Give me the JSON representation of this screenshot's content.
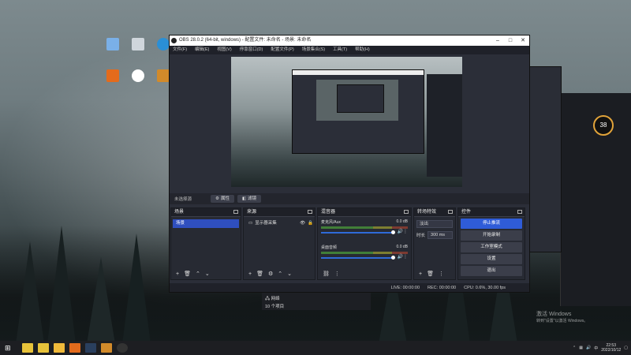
{
  "window": {
    "title": "OBS 28.0.2 (64-bit, windows) - 配置文件: 未命名 - 场景: 未命名",
    "menu": [
      "文件(F)",
      "编辑(E)",
      "视图(V)",
      "停靠窗口(D)",
      "配置文件(P)",
      "场景集合(S)",
      "工具(T)",
      "帮助(H)"
    ]
  },
  "scene_bar": {
    "label": "未选择源",
    "properties": "属性",
    "filters": "滤镜"
  },
  "docks": {
    "scenes": {
      "title": "场景",
      "items": [
        "场景"
      ]
    },
    "sources": {
      "title": "来源",
      "items": [
        "显示器采集"
      ]
    },
    "mixer": {
      "title": "混音器",
      "channels": [
        {
          "name": "麦克风/Aux",
          "db": "0.0 dB"
        },
        {
          "name": "桌面音频",
          "db": "0.0 dB"
        }
      ]
    },
    "transitions": {
      "title": "转场特效",
      "type": "淡出",
      "duration_label": "时长",
      "duration": "300 ms"
    },
    "controls": {
      "title": "控件",
      "buttons": [
        "停止推流",
        "开始录制",
        "工作室模式",
        "设置",
        "退出"
      ]
    }
  },
  "status": {
    "live": "LIVE: 00:00:00",
    "rec": "REC: 00:00:00",
    "cpu": "CPU: 0.6%, 30.00 fps"
  },
  "explorer": {
    "title": "网络",
    "count": "10 个项目"
  },
  "gauge": {
    "value": "38"
  },
  "watermark": {
    "line1": "激活 Windows",
    "line2": "转到\"设置\"以激活 Windows。"
  },
  "taskbar": {
    "time": "22:53",
    "date": "2022/10/12",
    "ime": "中"
  },
  "colors": {
    "accent": "#2f5cd8",
    "panel": "#272a33",
    "titlebar": "#ffffff"
  }
}
